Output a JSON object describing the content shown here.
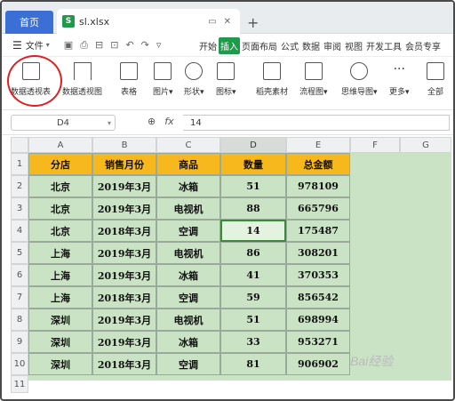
{
  "tabs": {
    "home": "首页",
    "file": "sl.xlsx",
    "sheet_badge": "S"
  },
  "menubar": {
    "file_menu": "文件",
    "items": [
      "开始",
      "插入",
      "页面布局",
      "公式",
      "数据",
      "审阅",
      "视图",
      "开发工具",
      "会员专享"
    ],
    "active_item": "插入"
  },
  "ribbon": {
    "buttons": [
      "数据透视表",
      "数据透视图",
      "表格",
      "图片",
      "形状",
      "图标",
      "稻壳素材",
      "流程图",
      "思维导图",
      "更多",
      "全部"
    ]
  },
  "formula_bar": {
    "cell_ref": "D4",
    "fx_label": "fx",
    "value": "14"
  },
  "sheet": {
    "columns": [
      "A",
      "B",
      "C",
      "D",
      "E",
      "F",
      "G"
    ],
    "rows": [
      "1",
      "2",
      "3",
      "4",
      "5",
      "6",
      "7",
      "8",
      "9",
      "10",
      "11"
    ],
    "header_row": [
      "分店",
      "销售月份",
      "商品",
      "数量",
      "总金额"
    ],
    "data": [
      [
        "北京",
        "2019年3月",
        "冰箱",
        "51",
        "978109"
      ],
      [
        "北京",
        "2019年3月",
        "电视机",
        "88",
        "665796"
      ],
      [
        "北京",
        "2018年3月",
        "空调",
        "14",
        "175487"
      ],
      [
        "上海",
        "2019年3月",
        "电视机",
        "86",
        "308201"
      ],
      [
        "上海",
        "2019年3月",
        "冰箱",
        "41",
        "370353"
      ],
      [
        "上海",
        "2018年3月",
        "空调",
        "59",
        "856542"
      ],
      [
        "深圳",
        "2019年3月",
        "电视机",
        "51",
        "698994"
      ],
      [
        "深圳",
        "2019年3月",
        "冰箱",
        "33",
        "953271"
      ],
      [
        "深圳",
        "2018年3月",
        "空调",
        "81",
        "906902"
      ]
    ],
    "selected_cell": "D4"
  },
  "colors": {
    "header_fill": "#f6b81c",
    "body_fill": "#c9e3c4",
    "active_tab": "#1e9a4a",
    "home_tab": "#3b6fd6",
    "highlight_circle": "#e02020"
  },
  "watermark": "Bai经验"
}
